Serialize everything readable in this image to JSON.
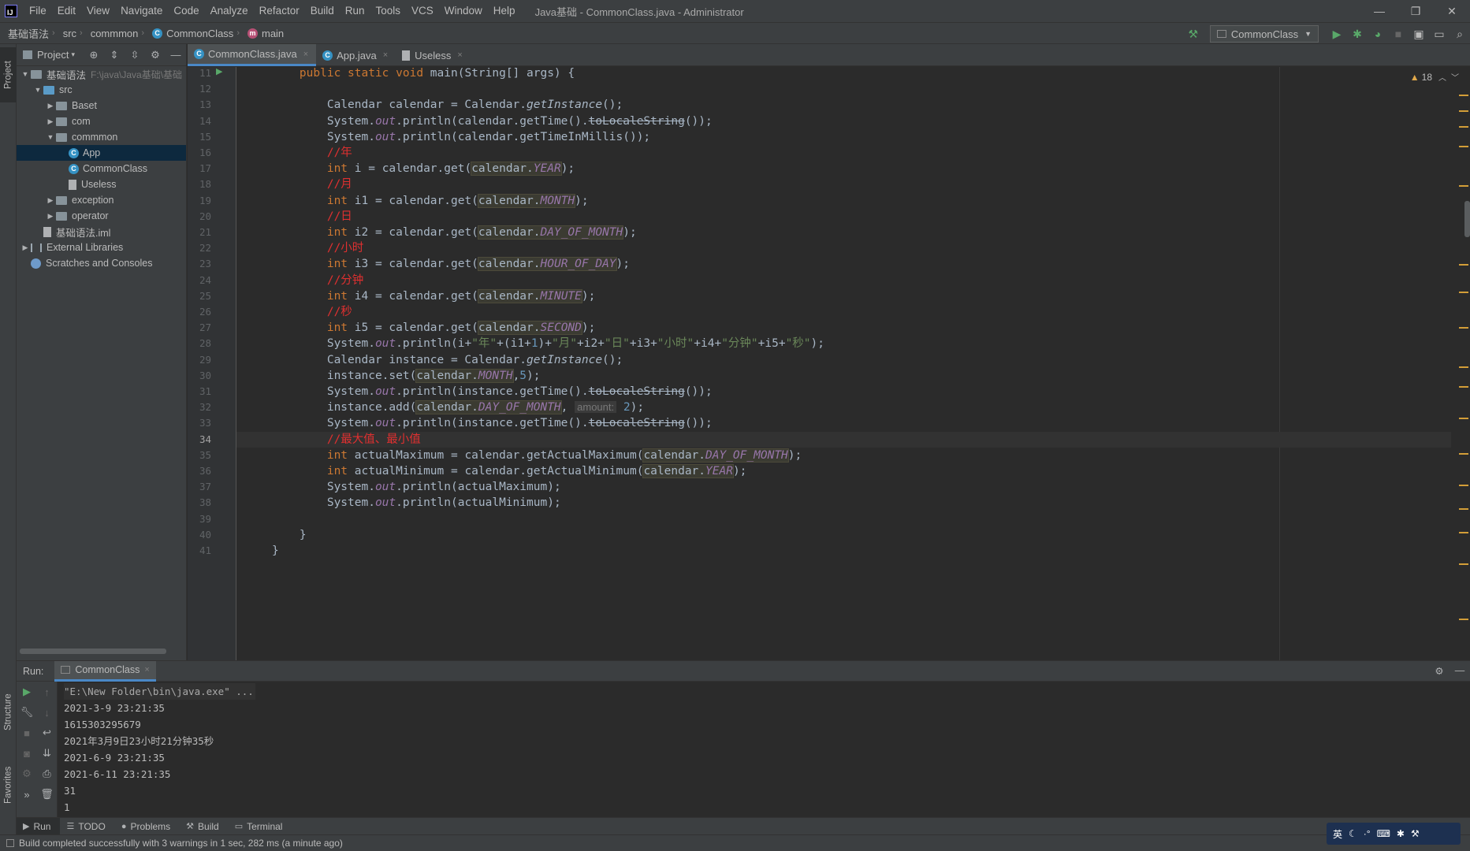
{
  "window": {
    "title": "Java基础 - CommonClass.java - Administrator",
    "logo": "IJ",
    "controls": [
      "—",
      "❐",
      "✕"
    ]
  },
  "menu": [
    "File",
    "Edit",
    "View",
    "Navigate",
    "Code",
    "Analyze",
    "Refactor",
    "Build",
    "Run",
    "Tools",
    "VCS",
    "Window",
    "Help"
  ],
  "breadcrumb": [
    "基础语法",
    "src",
    "commmon",
    "CommonClass",
    "main"
  ],
  "run_config": "CommonClass",
  "left_stripe": {
    "project": "Project",
    "structure": "Structure",
    "favorites": "Favorites"
  },
  "project_panel": {
    "title": "Project",
    "tree": [
      {
        "label": "基础语法",
        "extra": "F:\\java\\Java基础\\基础",
        "depth": 0,
        "expanded": true,
        "icon": "project-folder"
      },
      {
        "label": "src",
        "depth": 1,
        "expanded": true,
        "icon": "source-folder"
      },
      {
        "label": "Baset",
        "depth": 2,
        "expanded": false,
        "icon": "package"
      },
      {
        "label": "com",
        "depth": 2,
        "expanded": false,
        "icon": "package"
      },
      {
        "label": "commmon",
        "depth": 2,
        "expanded": true,
        "icon": "package"
      },
      {
        "label": "App",
        "depth": 3,
        "icon": "class",
        "selected": true
      },
      {
        "label": "CommonClass",
        "depth": 3,
        "icon": "class"
      },
      {
        "label": "Useless",
        "depth": 3,
        "icon": "file"
      },
      {
        "label": "exception",
        "depth": 2,
        "expanded": false,
        "icon": "package"
      },
      {
        "label": "operator",
        "depth": 2,
        "expanded": false,
        "icon": "package"
      },
      {
        "label": "基础语法.iml",
        "depth": 1,
        "icon": "iml-file"
      },
      {
        "label": "External Libraries",
        "depth": 0,
        "expanded": false,
        "icon": "library"
      },
      {
        "label": "Scratches and Consoles",
        "depth": 0,
        "icon": "scratches"
      }
    ]
  },
  "tabs": [
    {
      "label": "CommonClass.java",
      "active": true,
      "icon": "class"
    },
    {
      "label": "App.java",
      "active": false,
      "icon": "class"
    },
    {
      "label": "Useless",
      "active": false,
      "icon": "file"
    }
  ],
  "editor": {
    "warnings": "18",
    "current_line": 34,
    "lines": [
      {
        "n": 11,
        "html": "<span class='kw'>public static void</span> main(String[] args) {",
        "indent": 4
      },
      {
        "n": 12,
        "html": "",
        "indent": 0
      },
      {
        "n": 13,
        "html": "Calendar calendar = Calendar.<span class='stat'>getInstance</span>();",
        "indent": 8
      },
      {
        "n": 14,
        "html": "System.<span class='fld'>out</span>.println(calendar.getTime().<span class='strike'>toLocaleString</span>());",
        "indent": 8
      },
      {
        "n": 15,
        "html": "System.<span class='fld'>out</span>.println(calendar.getTimeInMillis());",
        "indent": 8
      },
      {
        "n": 16,
        "html": "<span class='cmt'>//年</span>",
        "indent": 8
      },
      {
        "n": 17,
        "html": "<span class='kw'>int</span> i = calendar.get(<span class='hl'>calendar.<span class='fld'>YEAR</span></span>);",
        "indent": 8
      },
      {
        "n": 18,
        "html": "<span class='cmt'>//月</span>",
        "indent": 8
      },
      {
        "n": 19,
        "html": "<span class='kw'>int</span> i1 = calendar.get(<span class='hl'>calendar.<span class='fld'>MONTH</span></span>);",
        "indent": 8
      },
      {
        "n": 20,
        "html": "<span class='cmt'>//日</span>",
        "indent": 8
      },
      {
        "n": 21,
        "html": "<span class='kw'>int</span> i2 = calendar.get(<span class='hl'>calendar.<span class='fld'>DAY_OF_MONTH</span></span>);",
        "indent": 8
      },
      {
        "n": 22,
        "html": "<span class='cmt'>//小时</span>",
        "indent": 8
      },
      {
        "n": 23,
        "html": "<span class='kw'>int</span> i3 = calendar.get(<span class='hl'>calendar.<span class='fld'>HOUR_OF_DAY</span></span>);",
        "indent": 8
      },
      {
        "n": 24,
        "html": "<span class='cmt'>//分钟</span>",
        "indent": 8
      },
      {
        "n": 25,
        "html": "<span class='kw'>int</span> i4 = calendar.get(<span class='hl'>calendar.<span class='fld'>MINUTE</span></span>);",
        "indent": 8
      },
      {
        "n": 26,
        "html": "<span class='cmt'>//秒</span>",
        "indent": 8
      },
      {
        "n": 27,
        "html": "<span class='kw'>int</span> i5 = calendar.get(<span class='hl'>calendar.<span class='fld'>SECOND</span></span>);",
        "indent": 8
      },
      {
        "n": 28,
        "html": "System.<span class='fld'>out</span>.println(i+<span class='str'>\"年\"</span>+(i1+<span class='num'>1</span>)+<span class='str'>\"月\"</span>+i2+<span class='str'>\"日\"</span>+i3+<span class='str'>\"小时\"</span>+i4+<span class='str'>\"分钟\"</span>+i5+<span class='str'>\"秒\"</span>);",
        "indent": 8
      },
      {
        "n": 29,
        "html": "Calendar instance = Calendar.<span class='stat'>getInstance</span>();",
        "indent": 8
      },
      {
        "n": 30,
        "html": "instance.set(<span class='hl'>calendar.<span class='fld'>MONTH</span></span>,<span class='num'>5</span>);",
        "indent": 8
      },
      {
        "n": 31,
        "html": "System.<span class='fld'>out</span>.println(instance.getTime().<span class='strike'>toLocaleString</span>());",
        "indent": 8
      },
      {
        "n": 32,
        "html": "instance.add(<span class='hl'>calendar.<span class='fld'>DAY_OF_MONTH</span></span>, <span class='hint'>amount:</span> <span class='num'>2</span>);",
        "indent": 8
      },
      {
        "n": 33,
        "html": "System.<span class='fld'>out</span>.println(instance.getTime().<span class='strike'>toLocaleString</span>());",
        "indent": 8
      },
      {
        "n": 34,
        "html": "<span class='cmt'>//最大值、最小值</span>",
        "indent": 8
      },
      {
        "n": 35,
        "html": "<span class='kw'>int</span> actualMaximum = calendar.getActualMaximum(<span class='hl'>calendar.<span class='fld'>DAY_OF_MONTH</span></span>);",
        "indent": 8
      },
      {
        "n": 36,
        "html": "<span class='kw'>int</span> actualMinimum = calendar.getActualMinimum(<span class='hl'>calendar.<span class='fld'>YEAR</span></span>);",
        "indent": 8
      },
      {
        "n": 37,
        "html": "System.<span class='fld'>out</span>.println(actualMaximum);",
        "indent": 8
      },
      {
        "n": 38,
        "html": "System.<span class='fld'>out</span>.println(actualMinimum);",
        "indent": 8
      },
      {
        "n": 39,
        "html": "",
        "indent": 0
      },
      {
        "n": 40,
        "html": "}",
        "indent": 4
      },
      {
        "n": 41,
        "html": "}",
        "indent": 0
      }
    ]
  },
  "run_panel": {
    "label": "Run:",
    "tab": "CommonClass",
    "output": [
      "\"E:\\New Folder\\bin\\java.exe\" ...",
      "2021-3-9 23:21:35",
      "1615303295679",
      "2021年3月9日23小时21分钟35秒",
      "2021-6-9 23:21:35",
      "2021-6-11 23:21:35",
      "31",
      "1"
    ]
  },
  "bottom_tabs": [
    {
      "label": "Run",
      "icon": "play-icon",
      "active": true
    },
    {
      "label": "TODO",
      "icon": "list-icon"
    },
    {
      "label": "Problems",
      "icon": "info-icon"
    },
    {
      "label": "Build",
      "icon": "hammer-icon"
    },
    {
      "label": "Terminal",
      "icon": "terminal-icon"
    }
  ],
  "status": "Build completed successfully with 3 warnings in 1 sec, 282 ms (a minute ago)",
  "ime": {
    "lang": "英"
  }
}
